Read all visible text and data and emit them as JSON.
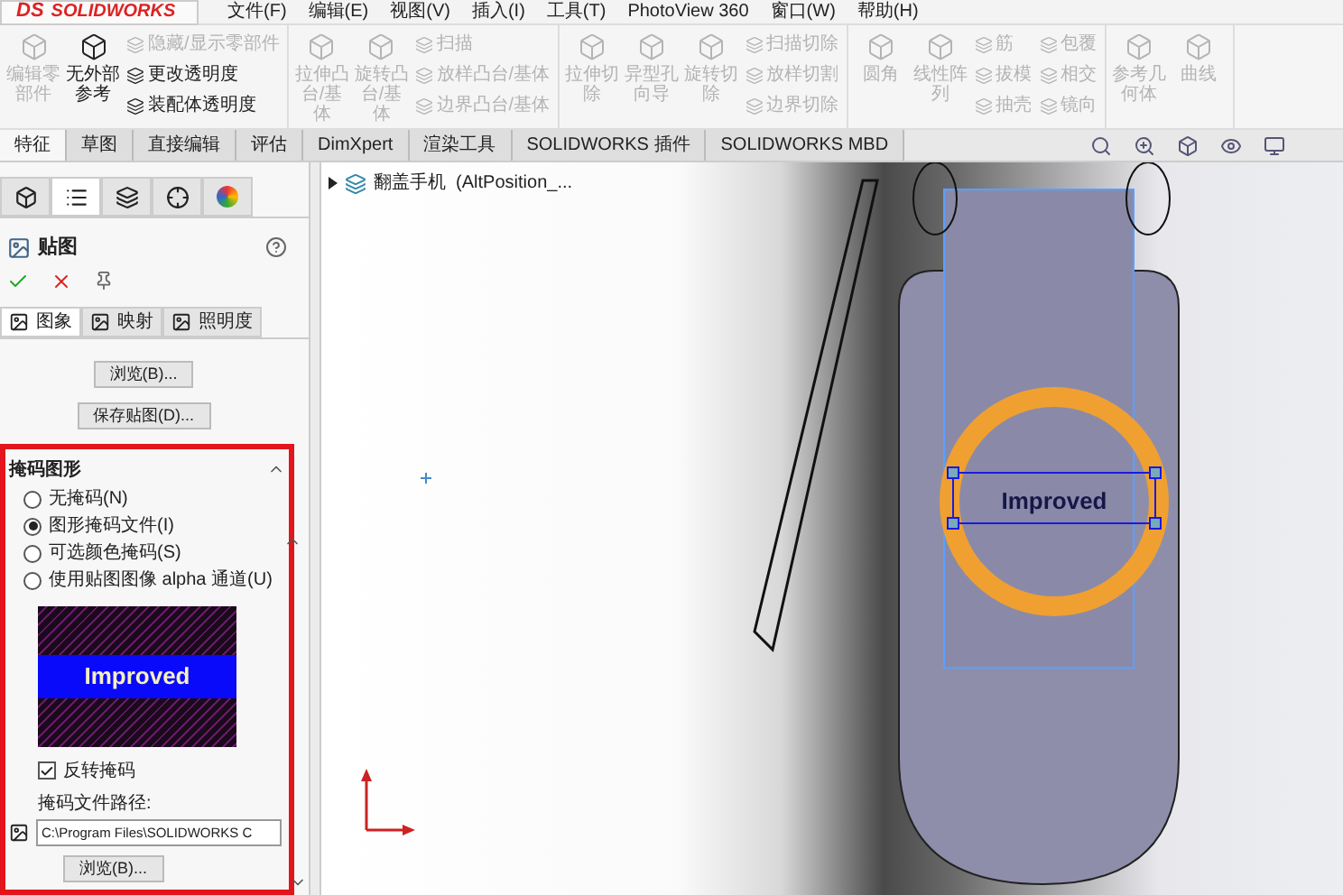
{
  "title_bar": {
    "logo_mark": "DS",
    "logo": "SOLIDWORKS",
    "menu": [
      "文件(F)",
      "编辑(E)",
      "视图(V)",
      "插入(I)",
      "工具(T)",
      "PhotoView 360",
      "窗口(W)",
      "帮助(H)"
    ]
  },
  "ribbon": {
    "groups": [
      {
        "items": [
          {
            "kind": "large",
            "label": "编辑零部件",
            "disabled": true
          },
          {
            "kind": "large",
            "label": "无外部参考",
            "disabled": false
          },
          {
            "kind": "stack",
            "entries": [
              {
                "label": "隐藏/显示零部件",
                "disabled": true
              },
              {
                "label": "更改透明度",
                "disabled": false
              },
              {
                "label": "装配体透明度",
                "disabled": false
              }
            ]
          }
        ]
      },
      {
        "items": [
          {
            "kind": "large",
            "label": "拉伸凸台/基体",
            "disabled": true
          },
          {
            "kind": "large",
            "label": "旋转凸台/基体",
            "disabled": true
          },
          {
            "kind": "stack",
            "entries": [
              {
                "label": "扫描",
                "disabled": true
              },
              {
                "label": "放样凸台/基体",
                "disabled": true
              },
              {
                "label": "边界凸台/基体",
                "disabled": true
              }
            ]
          }
        ]
      },
      {
        "items": [
          {
            "kind": "large",
            "label": "拉伸切除",
            "disabled": true
          },
          {
            "kind": "large",
            "label": "异型孔向导",
            "disabled": true
          },
          {
            "kind": "large",
            "label": "旋转切除",
            "disabled": true
          },
          {
            "kind": "stack",
            "entries": [
              {
                "label": "扫描切除",
                "disabled": true
              },
              {
                "label": "放样切割",
                "disabled": true
              },
              {
                "label": "边界切除",
                "disabled": true
              }
            ]
          }
        ]
      },
      {
        "items": [
          {
            "kind": "large",
            "label": "圆角",
            "disabled": true
          },
          {
            "kind": "large",
            "label": "线性阵列",
            "disabled": true
          },
          {
            "kind": "stack",
            "entries": [
              {
                "label": "筋",
                "disabled": true
              },
              {
                "label": "拔模",
                "disabled": true
              },
              {
                "label": "抽壳",
                "disabled": true
              }
            ]
          },
          {
            "kind": "stack",
            "entries": [
              {
                "label": "包覆",
                "disabled": true
              },
              {
                "label": "相交",
                "disabled": true
              },
              {
                "label": "镜向",
                "disabled": true
              }
            ]
          }
        ]
      },
      {
        "items": [
          {
            "kind": "large",
            "label": "参考几何体",
            "disabled": true
          },
          {
            "kind": "large",
            "label": "曲线",
            "disabled": true
          }
        ]
      }
    ]
  },
  "tabs": [
    {
      "label": "特征",
      "selected": true
    },
    {
      "label": "草图",
      "selected": false
    },
    {
      "label": "直接编辑",
      "selected": false
    },
    {
      "label": "评估",
      "selected": false
    },
    {
      "label": "DimXpert",
      "selected": false
    },
    {
      "label": "渲染工具",
      "selected": false
    },
    {
      "label": "SOLIDWORKS 插件",
      "selected": false
    },
    {
      "label": "SOLIDWORKS MBD",
      "selected": false
    }
  ],
  "panel": {
    "manager_tabs": [
      {
        "selected": false
      },
      {
        "selected": true
      },
      {
        "selected": false
      },
      {
        "selected": false
      },
      {
        "selected": false
      }
    ],
    "title": "贴图",
    "sub_tabs": [
      {
        "label": "图象",
        "selected": true
      },
      {
        "label": "映射",
        "selected": false
      },
      {
        "label": "照明度",
        "selected": false
      }
    ],
    "buttons": [
      "浏览(B)...",
      "保存贴图(D)..."
    ],
    "mask_section": {
      "title": "掩码图形",
      "options": [
        {
          "label": "无掩码(N)",
          "selected": false
        },
        {
          "label": "图形掩码文件(I)",
          "selected": true
        },
        {
          "label": "可选颜色掩码(S)",
          "selected": false
        },
        {
          "label": "使用贴图图像 alpha 通道(U)",
          "selected": false
        }
      ],
      "preview_text": "Improved",
      "invert": {
        "label": "反转掩码",
        "checked": true
      },
      "path_label": "掩码文件路径:",
      "path_value": "C:\\Program Files\\SOLIDWORKS C",
      "browse": "浏览(B)..."
    }
  },
  "tree": {
    "item": "翻盖手机  (AltPosition_..."
  },
  "viewport": {
    "decal_text": "Improved"
  }
}
